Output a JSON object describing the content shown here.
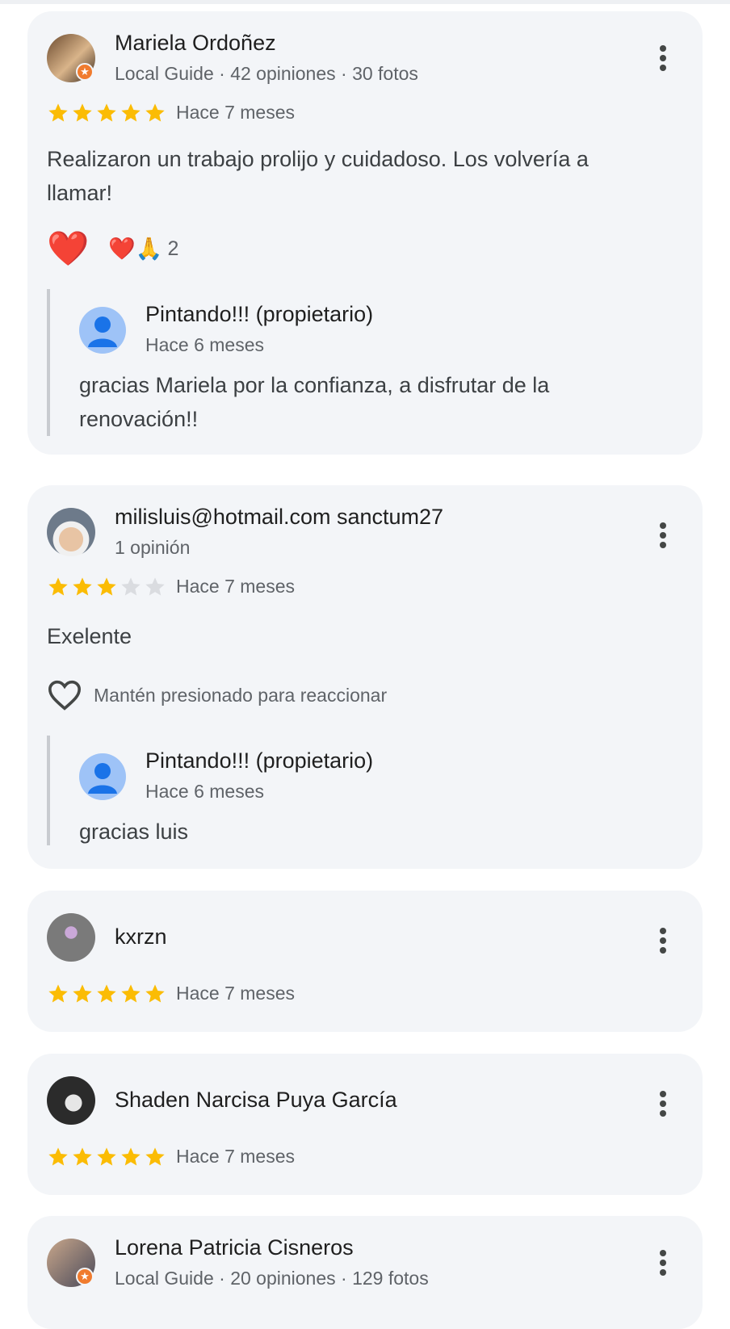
{
  "colors": {
    "star_filled": "#fbbc04",
    "star_empty": "#dadce0",
    "card_bg": "#f3f5f8",
    "owner_avatar": "#9ec3f7",
    "guide_badge": "#f07b2e"
  },
  "reviews": [
    {
      "name": "Mariela Ordoñez",
      "meta": "Local Guide · 42 opiniones · 30 fotos",
      "rating": 5,
      "when": "Hace 7 meses",
      "text": "Realizaron un trabajo prolijo y cuidadoso. Los volvería a llamar!",
      "reactions": {
        "main": "❤️",
        "summary": "❤️🙏",
        "count": "2"
      },
      "reply": {
        "name": "Pintando!!! (propietario)",
        "when": "Hace 6 meses",
        "text": "gracias Mariela por la confianza, a disfrutar de la renovación!!"
      }
    },
    {
      "name": "milisluis@hotmail.com sanctum27",
      "meta": "1 opinión",
      "rating": 3,
      "when": "Hace 7 meses",
      "text": "Exelente",
      "reaction_hint": "Mantén presionado para reaccionar",
      "reply": {
        "name": "Pintando!!! (propietario)",
        "when": "Hace 6 meses",
        "text": "gracias luis"
      }
    },
    {
      "name": "kxrzn",
      "rating": 5,
      "when": "Hace 7 meses"
    },
    {
      "name": "Shaden Narcisa Puya García",
      "rating": 5,
      "when": "Hace 7 meses"
    },
    {
      "name": "Lorena Patricia Cisneros",
      "meta": "Local Guide · 20 opiniones · 129 fotos"
    }
  ]
}
